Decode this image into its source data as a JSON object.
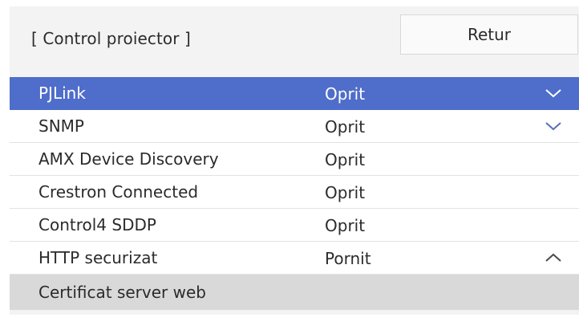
{
  "header": {
    "title": "[ Control proiector ]",
    "back_label": "Retur"
  },
  "settings": [
    {
      "label": "PJLink",
      "value": "Oprit",
      "icon": "chevron-down-icon",
      "selected": true
    },
    {
      "label": "SNMP",
      "value": "Oprit",
      "icon": "chevron-down-icon"
    },
    {
      "label": "AMX Device Discovery",
      "value": "Oprit"
    },
    {
      "label": "Crestron Connected",
      "value": "Oprit"
    },
    {
      "label": "Control4 SDDP",
      "value": "Oprit"
    },
    {
      "label": "HTTP securizat",
      "value": "Pornit",
      "icon": "chevron-up-icon"
    },
    {
      "label": "Certificat server web"
    }
  ],
  "colors": {
    "selected_row": "#4f6dca",
    "panel_background": "#f3f3f3",
    "subitem_background": "#d9d9d9"
  }
}
